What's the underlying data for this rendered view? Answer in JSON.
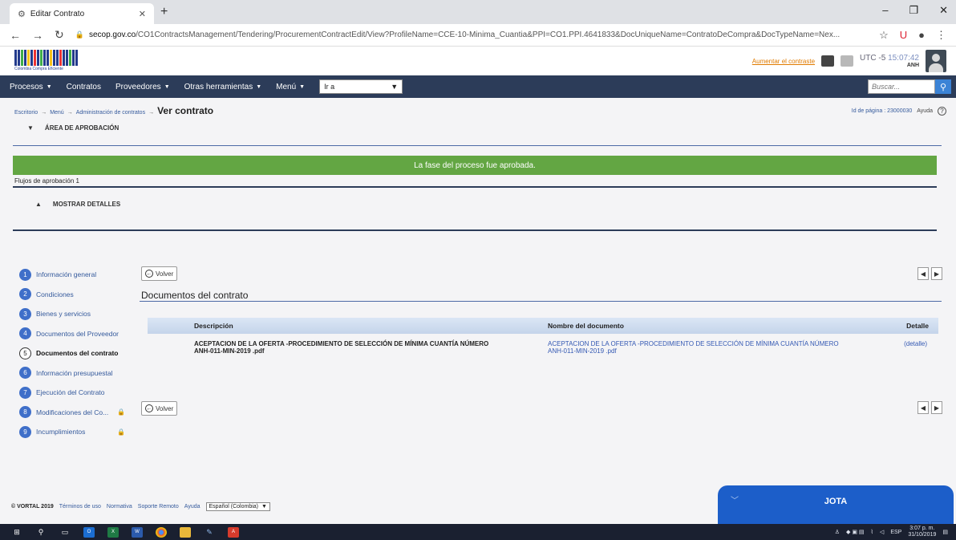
{
  "browser": {
    "tab_title": "Editar Contrato",
    "url_host": "secop.gov.co",
    "url_path": "/CO1ContractsManagement/Tendering/ProcurementContractEdit/View?ProfileName=CCE-10-Minima_Cuantia&PPI=CO1.PPI.4641833&DocUniqueName=ContratoDeCompra&DocTypeName=Nex..."
  },
  "header": {
    "logo_caption": "Colombia Compra Eficiente",
    "link": "Aumentar el contraste",
    "utc_label": "UTC -5",
    "utc_time": "15:07:42",
    "user": "ANH"
  },
  "nav": {
    "items": [
      "Procesos",
      "Contratos",
      "Proveedores",
      "Otras herramientas",
      "Menú"
    ],
    "ira": "Ir a",
    "search_placeholder": "Buscar..."
  },
  "breadcrumb": {
    "items": [
      "Escritorio",
      "Menú",
      "Administración de contratos"
    ],
    "current": "Ver contrato",
    "page_id": "Id de página : 23000030",
    "help": "Ayuda"
  },
  "approval": {
    "title": "ÁREA DE APROBACIÓN",
    "banner": "La fase del proceso fue aprobada.",
    "flows": "Flujos de aprobación 1",
    "show_details": "MOSTRAR DETALLES"
  },
  "steps": [
    {
      "num": "1",
      "label": "Información general"
    },
    {
      "num": "2",
      "label": "Condiciones"
    },
    {
      "num": "3",
      "label": "Bienes y servicios"
    },
    {
      "num": "4",
      "label": "Documentos del Proveedor"
    },
    {
      "num": "5",
      "label": "Documentos del contrato"
    },
    {
      "num": "6",
      "label": "Información presupuestal"
    },
    {
      "num": "7",
      "label": "Ejecución del Contrato"
    },
    {
      "num": "8",
      "label": "Modificaciones del Co..."
    },
    {
      "num": "9",
      "label": "Incumplimientos"
    }
  ],
  "content": {
    "back_label": "Volver",
    "section_title": "Documentos del contrato",
    "columns": [
      "Descripción",
      "Nombre del documento",
      "Detalle"
    ],
    "row": {
      "description": "ACEPTACION DE LA OFERTA -PROCEDIMIENTO DE SELECCIÓN DE MÍNIMA CUANTÍA NÚMERO ANH-011-MIN-2019 .pdf",
      "document_name": "ACEPTACION DE LA OFERTA -PROCEDIMIENTO DE SELECCIÓN DE MÍNIMA CUANTÍA NÚMERO ANH-011-MIN-2019 .pdf",
      "detail": "(detalle)"
    }
  },
  "footer": {
    "copyright": "© VORTAL 2019",
    "links": [
      "Términos de uso",
      "Normativa",
      "Soporte Remoto",
      "Ayuda"
    ],
    "language": "Español (Colombia)"
  },
  "chat": {
    "name": "JOTA"
  },
  "taskbar": {
    "lang": "ESP",
    "time": "3:07 p. m.",
    "date": "31/10/2019"
  },
  "colors": {
    "nav_bg": "#2c3c59",
    "banner_green": "#63a643",
    "step_blue": "#3f6fc9",
    "chat_blue": "#1c5ec9"
  }
}
